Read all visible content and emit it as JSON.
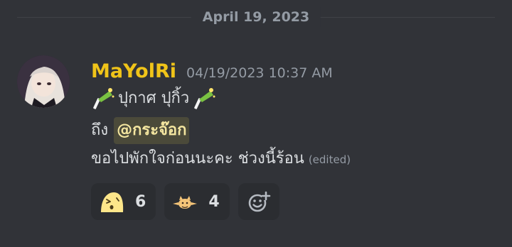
{
  "divider": {
    "date": "April 19, 2023"
  },
  "message": {
    "username": "MaYolRi",
    "username_color": "#f0c419",
    "timestamp": "04/19/2023 10:37 AM",
    "line1_text": "ปุกาศ ปุกิ้ว",
    "line2_prefix": "ถึง",
    "mention": "@กระจ๊อก",
    "line3_text": "ขอไปพักใจก่อนนะคะ ช่วงนี้ร้อน",
    "edited_label": "(edited)"
  },
  "reactions": [
    {
      "icon": "yellow-blob-emoji-icon",
      "count": "6"
    },
    {
      "icon": "cat-pointing-emoji-icon",
      "count": "4"
    }
  ],
  "add_reaction_icon": "add-emoji-icon"
}
